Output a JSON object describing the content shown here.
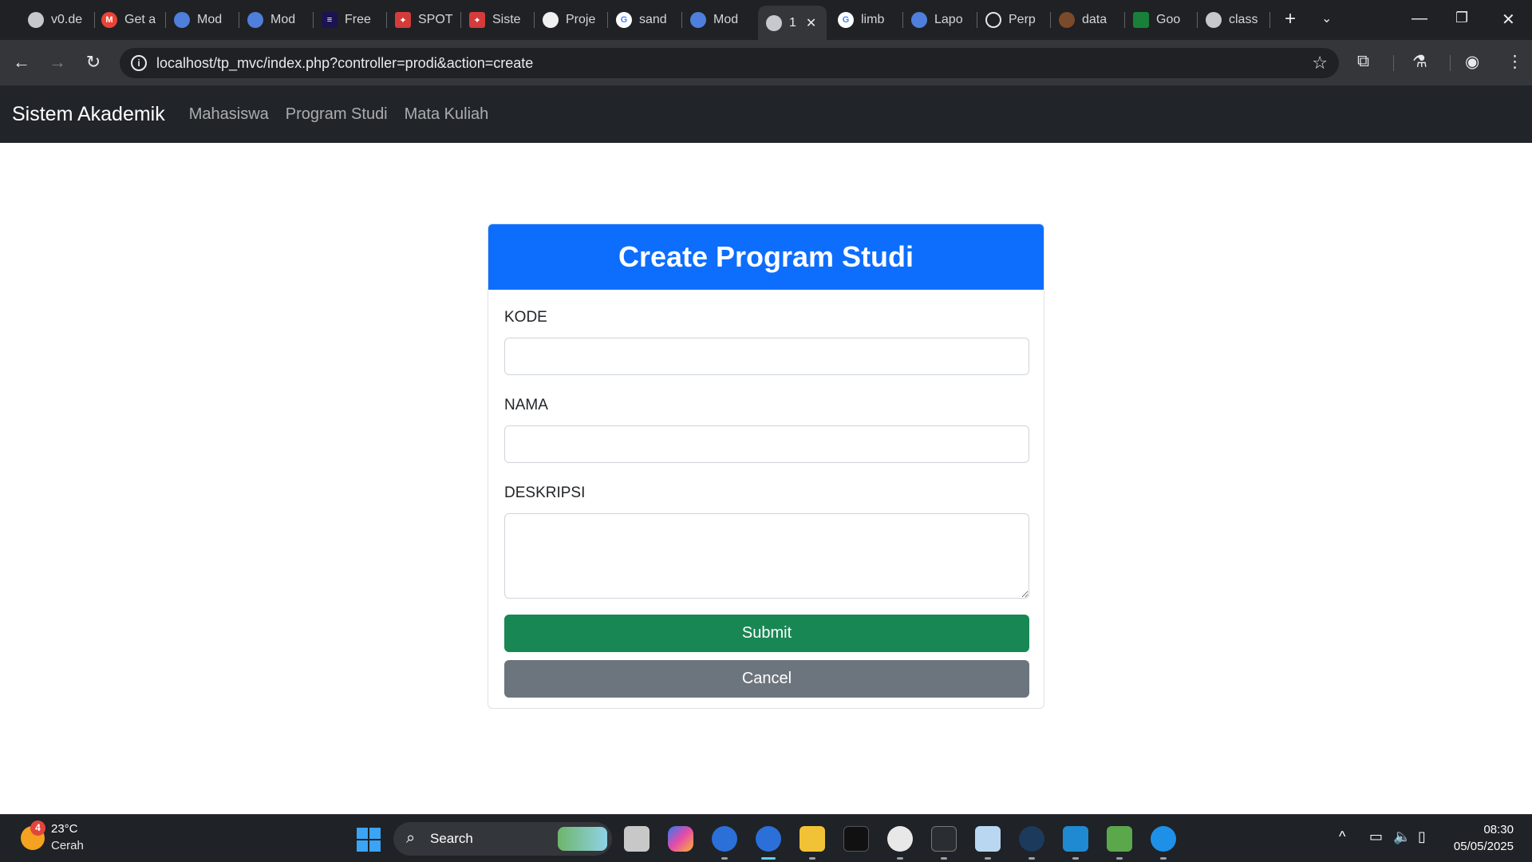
{
  "browser": {
    "tabs": [
      {
        "title": "v0.de",
        "favicon": "globe-icon"
      },
      {
        "title": "Get a",
        "favicon": "gmail-icon"
      },
      {
        "title": "Mod",
        "favicon": "doc-icon"
      },
      {
        "title": "Mod",
        "favicon": "doc-icon"
      },
      {
        "title": "Free",
        "favicon": "elementor-icon"
      },
      {
        "title": "SPOT",
        "favicon": "spot-icon"
      },
      {
        "title": "Siste",
        "favicon": "siste-icon"
      },
      {
        "title": "Proje",
        "favicon": "github-icon"
      },
      {
        "title": "sand",
        "favicon": "google-icon"
      },
      {
        "title": "Mod",
        "favicon": "doc-icon"
      },
      {
        "title": "1",
        "favicon": "globe-icon",
        "active": true
      },
      {
        "title": "limb",
        "favicon": "google-icon"
      },
      {
        "title": "Lapo",
        "favicon": "doc-icon"
      },
      {
        "title": "Perp",
        "favicon": "perplexity-icon"
      },
      {
        "title": "data",
        "favicon": "data-icon"
      },
      {
        "title": "Goo",
        "favicon": "sheets-icon"
      },
      {
        "title": "class",
        "favicon": "globe-icon"
      }
    ],
    "url": "localhost/tp_mvc/index.php?controller=prodi&action=create"
  },
  "navbar": {
    "brand": "Sistem Akademik",
    "links": [
      "Mahasiswa",
      "Program Studi",
      "Mata Kuliah"
    ]
  },
  "form": {
    "title": "Create Program Studi",
    "fields": [
      {
        "label": "KODE",
        "value": ""
      },
      {
        "label": "NAMA",
        "value": ""
      },
      {
        "label": "DESKRIPSI",
        "value": ""
      }
    ],
    "submit_label": "Submit",
    "cancel_label": "Cancel"
  },
  "colors": {
    "header": "#0d6efd",
    "submit": "#198754",
    "cancel": "#6c757d",
    "navbar": "#212529"
  },
  "taskbar": {
    "weather_temp": "23°C",
    "weather_condition": "Cerah",
    "weather_badge": "4",
    "search_label": "Search",
    "time": "08:30",
    "date": "05/05/2025"
  }
}
